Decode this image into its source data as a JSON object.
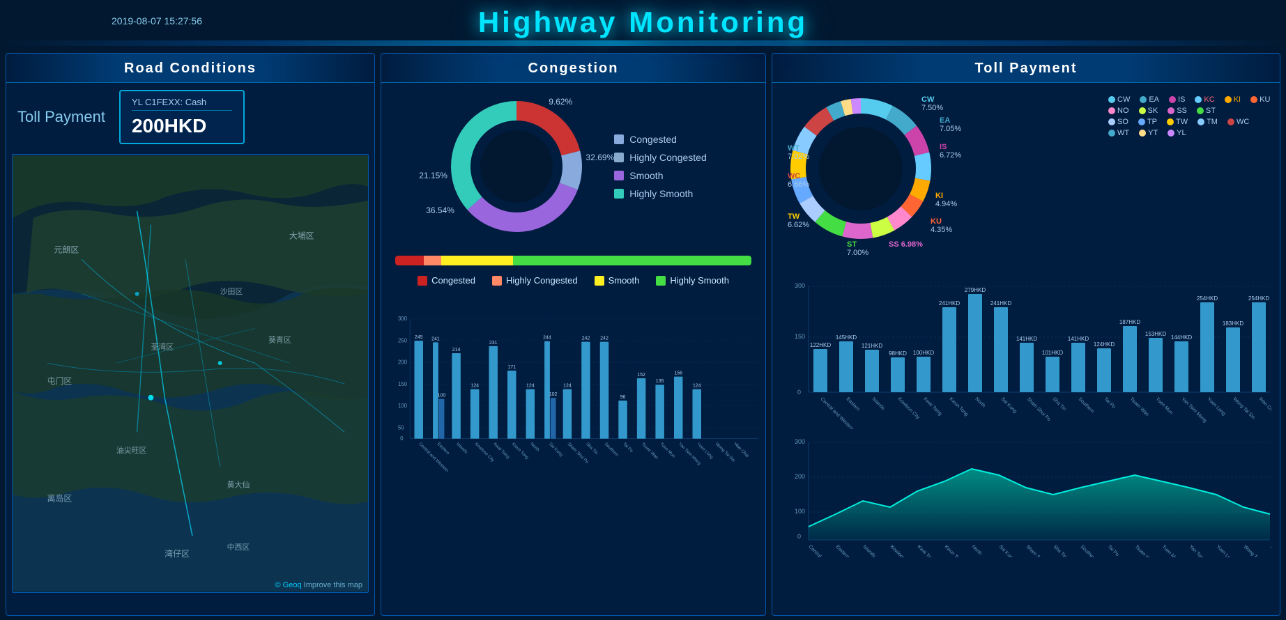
{
  "header": {
    "title": "Highway Monitoring",
    "datetime": "2019-08-07 15:27:56"
  },
  "panels": {
    "left": {
      "title": "Road Conditions",
      "toll_label": "Toll Payment",
      "toll_subtitle": "YL C1FEXX:  Cash",
      "toll_amount": "200HKD",
      "map_credit": "© Geoq Improve this map"
    },
    "center": {
      "title": "Congestion",
      "donut": {
        "segments": [
          {
            "label": "Congested",
            "pct": 21.15,
            "color": "#cc3333"
          },
          {
            "label": "Highly Congested",
            "pct": 9.62,
            "color": "#88aacc"
          },
          {
            "label": "Smooth",
            "pct": 32.69,
            "color": "#9966dd"
          },
          {
            "label": "Highly Smooth",
            "pct": 36.54,
            "color": "#33ccbb"
          }
        ],
        "pct_labels": [
          {
            "text": "9.62%",
            "pos": "top-right"
          },
          {
            "text": "32.69%",
            "pos": "right"
          },
          {
            "text": "36.54%",
            "pos": "bottom-left"
          },
          {
            "text": "21.15%",
            "pos": "left"
          }
        ]
      },
      "progress_bar": [
        {
          "color": "#cc2222",
          "pct": 8
        },
        {
          "color": "#ff8866",
          "pct": 5
        },
        {
          "color": "#ffee22",
          "pct": 20
        },
        {
          "color": "#44dd44",
          "pct": 67
        }
      ],
      "prog_legend": [
        "Congested",
        "Highly Congested",
        "Smooth",
        "Highly Smooth"
      ],
      "prog_colors": [
        "#cc2222",
        "#ff8866",
        "#ffee22",
        "#44dd44"
      ],
      "bar_chart": {
        "y_max": 300,
        "y_ticks": [
          300,
          250,
          200,
          150,
          100,
          50,
          0
        ],
        "districts": [
          {
            "name": "Central and Western",
            "v1": 245,
            "v2": null
          },
          {
            "name": "Eastern",
            "v1": 241,
            "v2": 100
          },
          {
            "name": "Islands",
            "v1": 214,
            "v2": null
          },
          {
            "name": "Kowloon City",
            "v1": 124,
            "v2": null
          },
          {
            "name": "Kwai Tsing",
            "v1": 231,
            "v2": null
          },
          {
            "name": "Kwun Tong",
            "v1": 171,
            "v2": null
          },
          {
            "name": "North",
            "v1": 124,
            "v2": null
          },
          {
            "name": "Sai Kung",
            "v1": 244,
            "v2": 102
          },
          {
            "name": "Sham Shui Po",
            "v1": 124,
            "v2": null
          },
          {
            "name": "Sha Tin",
            "v1": 242,
            "v2": null
          },
          {
            "name": "Southern",
            "v1": 242,
            "v2": null
          },
          {
            "name": "Tai Po",
            "v1": 96,
            "v2": null
          },
          {
            "name": "Tsuen Wan",
            "v1": 152,
            "v2": null
          },
          {
            "name": "Tuen Mun",
            "v1": 135,
            "v2": null
          },
          {
            "name": "Yan Tsim Mong",
            "v1": 156,
            "v2": null
          },
          {
            "name": "Yuen Long",
            "v1": 124,
            "v2": null
          },
          {
            "name": "Wong Tai Sin",
            "v1": null,
            "v2": null
          },
          {
            "name": "Wan Chai",
            "v1": null,
            "v2": null
          }
        ]
      }
    },
    "right": {
      "title": "Toll Payment",
      "donut_segments": [
        {
          "code": "CW",
          "pct": 7.5,
          "color": "#55ccee"
        },
        {
          "code": "EA",
          "pct": 7.05,
          "color": "#44aacc"
        },
        {
          "code": "IS",
          "pct": 6.72,
          "color": "#cc44aa"
        },
        {
          "code": "KI",
          "pct": 4.94,
          "color": "#ffaa00"
        },
        {
          "code": "KU",
          "pct": 4.35,
          "color": "#ff6633"
        },
        {
          "code": "SS",
          "pct": 6.98,
          "color": "#dd66cc"
        },
        {
          "code": "ST",
          "pct": 7.0,
          "color": "#44dd44"
        },
        {
          "code": "TW",
          "pct": 6.62,
          "color": "#ffcc00"
        },
        {
          "code": "WC",
          "pct": 6.66,
          "color": "#cc4444"
        },
        {
          "code": "WT",
          "pct": 7.02,
          "color": "#44aacc"
        },
        {
          "code": "KC",
          "pct": 6.5,
          "color": "#66ccff"
        },
        {
          "code": "SO",
          "pct": 5.5,
          "color": "#aaccff"
        },
        {
          "code": "TP",
          "pct": 5.8,
          "color": "#66aaff"
        },
        {
          "code": "TM",
          "pct": 6.0,
          "color": "#88ccff"
        },
        {
          "code": "NO",
          "pct": 5.0,
          "color": "#ff88cc"
        },
        {
          "code": "SK",
          "pct": 5.2,
          "color": "#ccff44"
        },
        {
          "code": "YT",
          "pct": 4.5,
          "color": "#ffdd88"
        },
        {
          "code": "YL",
          "pct": 4.2,
          "color": "#cc88ff"
        }
      ],
      "legend_row1": [
        {
          "code": "CW",
          "color": "#55ccee"
        },
        {
          "code": "EA",
          "color": "#44aacc"
        },
        {
          "code": "IS",
          "color": "#cc44aa"
        },
        {
          "code": "KC",
          "color": "#66ccff"
        },
        {
          "code": "KI",
          "color": "#ffaa00"
        },
        {
          "code": "KU",
          "color": "#ff6633"
        },
        {
          "code": "NO",
          "color": "#ff88cc"
        },
        {
          "code": "SK",
          "color": "#ccff44"
        },
        {
          "code": "SS",
          "color": "#dd66cc"
        },
        {
          "code": "ST",
          "color": "#44dd44"
        }
      ],
      "legend_row2": [
        {
          "code": "SO",
          "color": "#aaccff"
        },
        {
          "code": "TP",
          "color": "#66aaff"
        },
        {
          "code": "TW",
          "color": "#ffcc00"
        },
        {
          "code": "TM",
          "color": "#88ccff"
        },
        {
          "code": "WC",
          "color": "#cc4444"
        },
        {
          "code": "WT",
          "color": "#44aacc"
        },
        {
          "code": "YT",
          "color": "#ffdd88"
        },
        {
          "code": "YL",
          "color": "#cc88ff"
        }
      ],
      "bar_chart": {
        "y_max": 300,
        "districts": [
          {
            "name": "Central and Western",
            "v": 122
          },
          {
            "name": "Eastern",
            "v": 145
          },
          {
            "name": "Islands",
            "v": 121
          },
          {
            "name": "Kowloon City",
            "v": 98
          },
          {
            "name": "Kwai Tsing",
            "v": 100
          },
          {
            "name": "Kwun Tong",
            "v": 241
          },
          {
            "name": "North",
            "v": 279
          },
          {
            "name": "Sai Kung",
            "v": 241
          },
          {
            "name": "Sham Shui Po",
            "v": 141
          },
          {
            "name": "Sha Tin",
            "v": 101
          },
          {
            "name": "Southern",
            "v": 141
          },
          {
            "name": "Tai Po",
            "v": 124
          },
          {
            "name": "Tsuen Wan",
            "v": 187
          },
          {
            "name": "Tuen Mun",
            "v": 153
          },
          {
            "name": "Yan Tsim Mong",
            "v": 144
          },
          {
            "name": "Yuen Long",
            "v": 254
          },
          {
            "name": "Wong Tai Sin",
            "v": 183
          },
          {
            "name": "Wan Chai",
            "v": 254
          }
        ],
        "top_labels": [
          {
            "name": "Central and Western",
            "v": null
          },
          {
            "name": "Eastern",
            "v": 145
          },
          {
            "name": "Islands",
            "v": null
          },
          {
            "name": "Kowloon City",
            "v": null
          },
          {
            "name": "Kwai Tsing",
            "v": null
          },
          {
            "name": "Kwun Tong",
            "v": 241
          },
          {
            "name": "North",
            "v": 279
          },
          {
            "name": "Sai Kung",
            "v": 241
          },
          {
            "name": "Sham Shui Po",
            "v": 141
          },
          {
            "name": "Sha Tin",
            "v": null
          },
          {
            "name": "Southern",
            "v": 141
          },
          {
            "name": "Tai Po",
            "v": 124
          },
          {
            "name": "Tsuen Wan",
            "v": 187
          },
          {
            "name": "Tuen Mun",
            "v": 153
          },
          {
            "name": "Yan Tsim Mong",
            "v": 144
          },
          {
            "name": "Yuen Long",
            "v": 254
          },
          {
            "name": "Wong Tai Sin",
            "v": 183
          },
          {
            "name": "Wan Chai",
            "v": 254
          }
        ]
      },
      "area_chart": {
        "y_max": 300,
        "y_ticks": [
          300,
          200,
          100,
          0
        ],
        "values": [
          40,
          80,
          120,
          100,
          150,
          180,
          220,
          200,
          160,
          140,
          160,
          180,
          200,
          180,
          160,
          140,
          100,
          80
        ]
      }
    }
  }
}
